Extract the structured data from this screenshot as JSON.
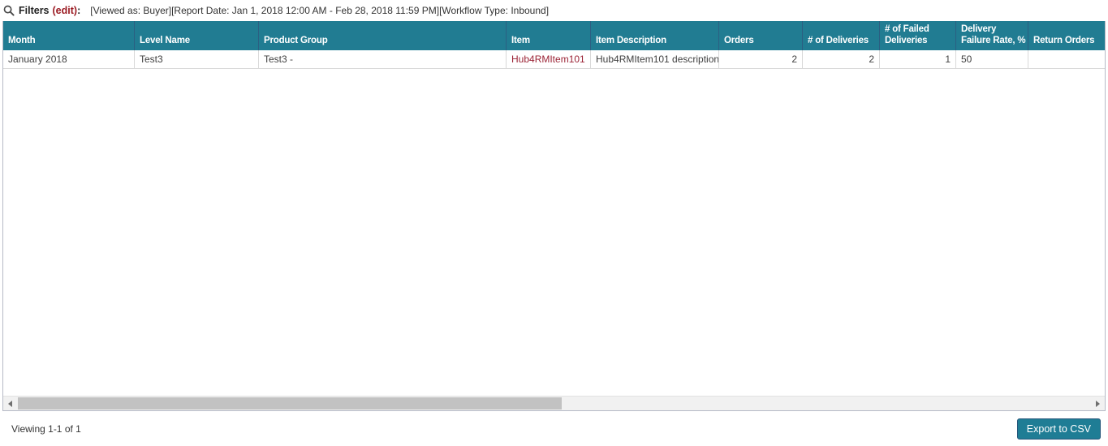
{
  "filters": {
    "icon": "search-icon",
    "label": "Filters",
    "edit_link": "(edit)",
    "colon": ":",
    "summary": "[Viewed as: Buyer][Report Date: Jan 1, 2018 12:00 AM - Feb 28, 2018 11:59 PM][Workflow Type: Inbound]"
  },
  "grid": {
    "columns": [
      {
        "label": "Month",
        "label_lines": [
          "Month"
        ]
      },
      {
        "label": "Level Name",
        "label_lines": [
          "Level Name"
        ]
      },
      {
        "label": "Product Group",
        "label_lines": [
          "Product Group"
        ]
      },
      {
        "label": "Item",
        "label_lines": [
          "Item"
        ]
      },
      {
        "label": "Item Description",
        "label_lines": [
          "Item Description"
        ]
      },
      {
        "label": "Orders",
        "label_lines": [
          "Orders"
        ]
      },
      {
        "label": "# of Deliveries",
        "label_lines": [
          "# of Deliveries"
        ]
      },
      {
        "label": "# of Failed Deliveries",
        "label_lines": [
          "# of Failed",
          "Deliveries"
        ]
      },
      {
        "label": "Delivery Failure Rate, %",
        "label_lines": [
          "Delivery",
          "Failure Rate, %"
        ]
      },
      {
        "label": "Return Orders",
        "label_lines": [
          "Return Orders"
        ]
      }
    ],
    "row": {
      "cells": [
        "January 2018",
        "Test3",
        "Test3 -",
        "Hub4RMItem101",
        "Hub4RMItem101 description",
        "2",
        "2",
        "1",
        "50",
        ""
      ]
    }
  },
  "footer": {
    "viewing_text": "Viewing 1-1 of 1",
    "export_button_label": "Export to CSV"
  },
  "colors": {
    "header_bg": "#217C92",
    "header_separator": "#2B5F82",
    "row_border": "#D9D9D9",
    "grid_border": "#B6BAC6",
    "item_link_red": "#9B2335",
    "edit_link_red": "#9B1B23",
    "export_button_bg": "#1F7D95",
    "export_button_border": "#25567B",
    "scrollbar_thumb": "#C2C2C2",
    "scrollbar_track": "#F1F1F1"
  }
}
